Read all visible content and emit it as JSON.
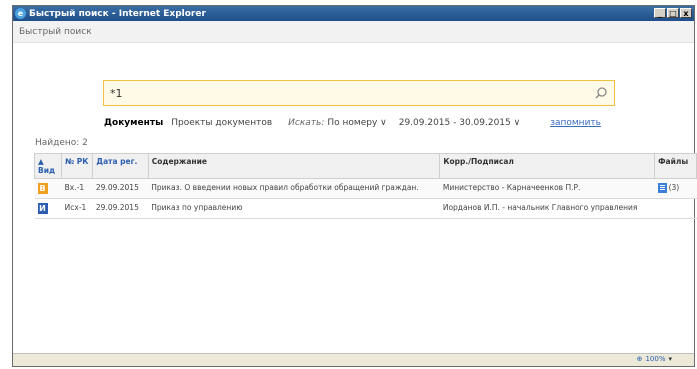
{
  "window": {
    "title": "Быстрый поиск - Internet Explorer",
    "icon": "ie-icon",
    "buttons": [
      "_",
      "□",
      "x"
    ]
  },
  "page_title": "Быстрый поиск",
  "search": {
    "value": "*1",
    "icon": "search-icon"
  },
  "filters": {
    "documents": "Документы",
    "projects": "Проекты документов",
    "search_by_label": "Искать:",
    "search_by_value": "По номеру ∨",
    "date_range": "29.09.2015 - 30.09.2015 ∨",
    "save": "запомнить"
  },
  "found_label": "Найдено: 2",
  "table": {
    "columns": [
      "▲ Вид",
      "№ РК",
      "Дата рег.",
      "Содержание",
      "Корр./Подписал",
      "Файлы"
    ],
    "rows": [
      {
        "kind": "В",
        "kind_color": "#f0a020",
        "number": "Вх.-1",
        "date": "29.09.2015",
        "content": "Приказ. О введении новых правил обработки обращений граждан.",
        "correspondent": "Министерство - Карначеенков П.Р.",
        "files": "(3)"
      },
      {
        "kind": "И",
        "kind_color": "#2a5db0",
        "number": "Исх-1",
        "date": "29.09.2015",
        "content": "Приказ по управлению",
        "correspondent": "Иорданов И.П. - начальник Главного управления",
        "files": ""
      }
    ]
  },
  "status": {
    "zoom": "100%",
    "zoom_arrow": "▾"
  }
}
